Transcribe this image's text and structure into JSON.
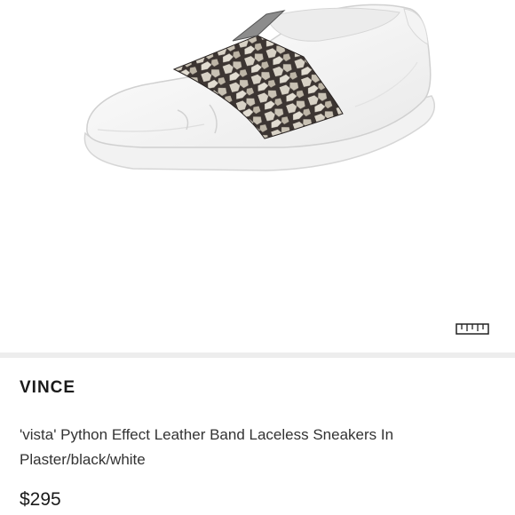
{
  "product": {
    "image_alt": "White leather sneaker with python effect band",
    "brand": "VINCE",
    "title": "'vista' Python Effect Leather Band Laceless Sneakers In Plaster/black/white",
    "price": "$295"
  },
  "icons": {
    "size_chart": "ruler-icon"
  },
  "colors": {
    "background": "#ffffff",
    "divider": "#ededed",
    "text_primary": "#1a1a1a",
    "text_secondary": "#333333"
  }
}
